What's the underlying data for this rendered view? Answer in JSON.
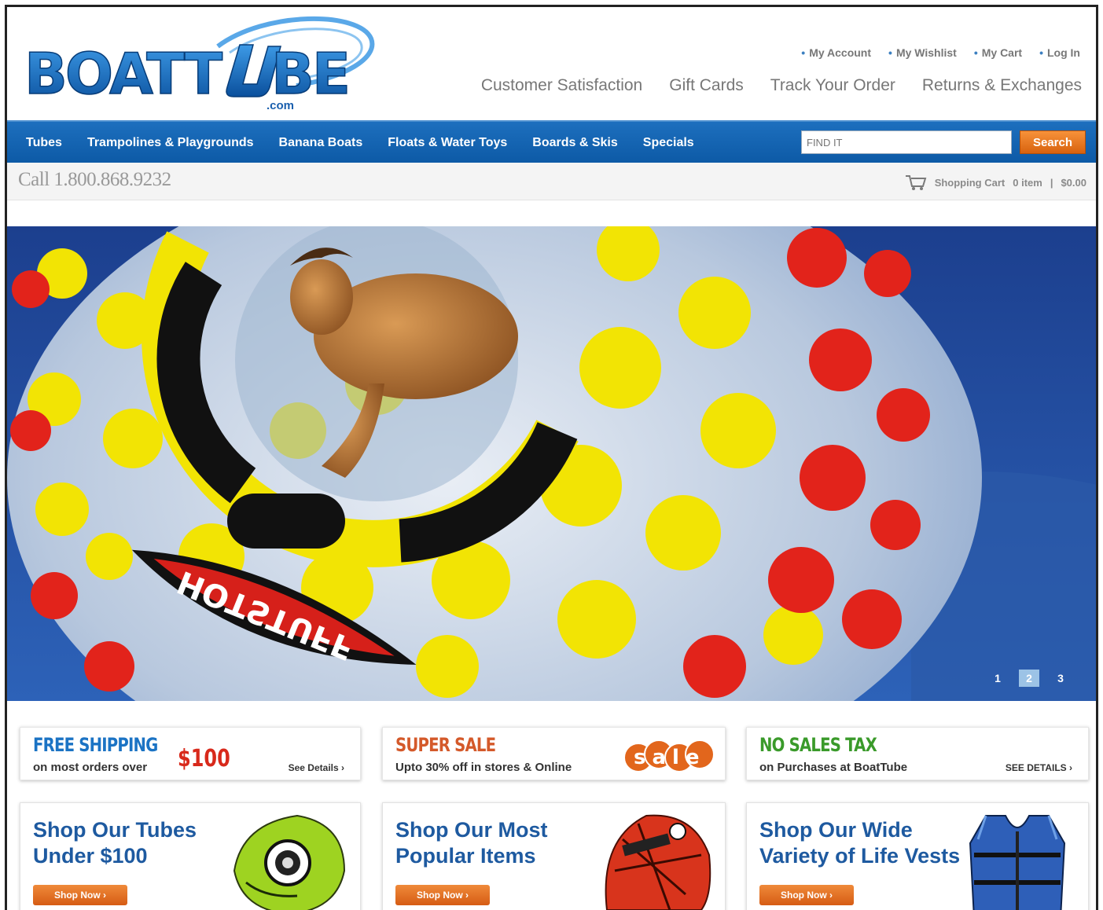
{
  "brand": {
    "name_part1": "BOATT",
    "name_part2": "BE",
    "domain": ".com"
  },
  "utility_links": [
    "My Account",
    "My Wishlist",
    "My Cart",
    "Log In"
  ],
  "secondary_nav": [
    "Customer Satisfaction",
    "Gift Cards",
    "Track Your Order",
    "Returns & Exchanges"
  ],
  "main_nav": [
    "Tubes",
    "Trampolines & Playgrounds",
    "Banana Boats",
    "Floats & Water Toys",
    "Boards & Skis",
    "Specials"
  ],
  "search": {
    "placeholder": "FIND IT",
    "button_label": "Search"
  },
  "call": "Call 1.800.868.9232",
  "cart": {
    "label": "Shopping Cart",
    "items": "0 item",
    "separator": "|",
    "total": "$0.00"
  },
  "hero": {
    "banner_text": "HOTSTUFF",
    "slides": [
      "1",
      "2",
      "3"
    ],
    "active_slide": 2
  },
  "promos": [
    {
      "title": "FREE SHIPPING",
      "subtitle": "on most orders over",
      "amount": "$100",
      "link": "See Details ›",
      "color": "#1b73c4"
    },
    {
      "title": "SUPER SALE",
      "subtitle": "Upto 30% off in stores & Online",
      "badge": "sale",
      "color": "#d4592a"
    },
    {
      "title": "NO SALES TAX",
      "subtitle": "on Purchases at BoatTube",
      "link": "SEE DETAILS ›",
      "color": "#3a9a2a"
    }
  ],
  "shop_panels": [
    {
      "title": "Shop Our Tubes Under $100",
      "button": "Shop Now ›",
      "image": "green-tube"
    },
    {
      "title": "Shop Our Most Popular Items",
      "button": "Shop Now ›",
      "image": "red-tube"
    },
    {
      "title": "Shop Our Wide Variety of Life Vests",
      "button": "Shop Now ›",
      "image": "life-vest"
    }
  ],
  "colors": {
    "nav_blue": "#1365b3",
    "logo_blue": "#1a6fbf",
    "accent_orange": "#e1701d",
    "shop_title_blue": "#1e5aa0"
  }
}
